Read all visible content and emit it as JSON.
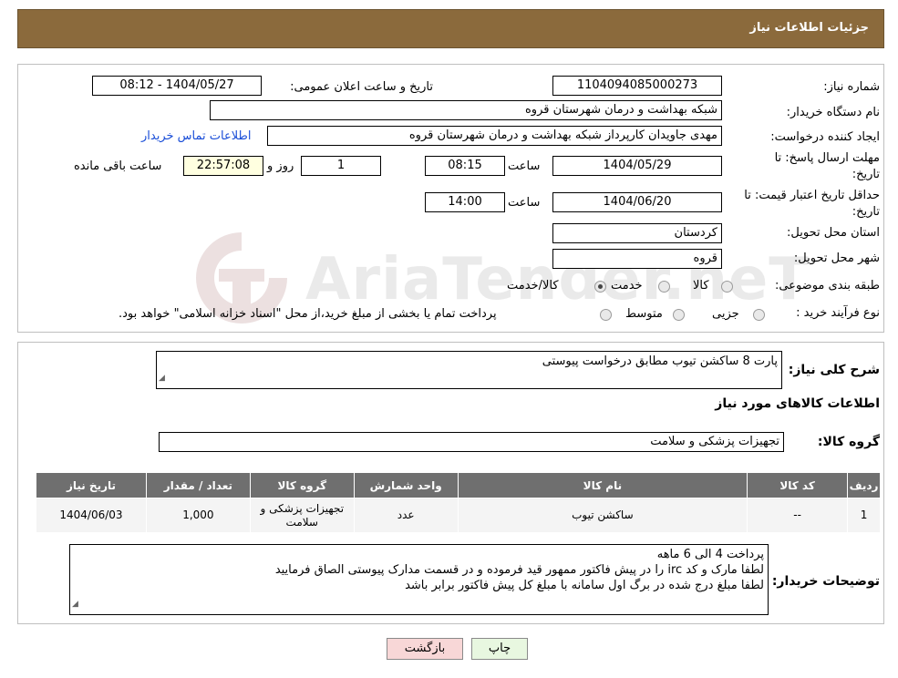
{
  "header": {
    "title": "جزئیات اطلاعات نیاز"
  },
  "fields": {
    "need_number_label": "شماره نیاز:",
    "need_number": "1104094085000273",
    "announce_label": "تاریخ و ساعت اعلان عمومی:",
    "announce_value": "1404/05/27 - 08:12",
    "buyer_org_label": "نام دستگاه خریدار:",
    "buyer_org": "شبکه بهداشت و درمان شهرستان قروه",
    "requester_label": "ایجاد کننده درخواست:",
    "requester": "مهدی جاویدان کارپرداز شبکه بهداشت و درمان شهرستان قروه",
    "contact_link": "اطلاعات تماس خریدار",
    "deadline_label_1": "مهلت ارسال پاسخ: تا",
    "deadline_label_2": "تاریخ:",
    "deadline_date": "1404/05/29",
    "time_label": "ساعت",
    "deadline_time": "08:15",
    "days_value": "1",
    "days_label": "روز و",
    "remaining_time": "22:57:08",
    "remaining_label": "ساعت باقی مانده",
    "validity_label_1": "حداقل تاریخ اعتبار قیمت: تا",
    "validity_label_2": "تاریخ:",
    "validity_date": "1404/06/20",
    "validity_time": "14:00",
    "province_label": "استان محل تحویل:",
    "province": "کردستان",
    "city_label": "شهر محل تحویل:",
    "city": "قروه",
    "category_label": "طبقه بندی موضوعی:",
    "category_options": [
      "کالا",
      "خدمت",
      "کالا/خدمت"
    ],
    "purchase_type_label": "نوع فرآیند خرید :",
    "purchase_options": [
      "جزیی",
      "متوسط"
    ],
    "purchase_note": "پرداخت تمام یا بخشی از مبلغ خرید،از محل \"اسناد خزانه اسلامی\" خواهد بود."
  },
  "description": {
    "label": "شرح کلی نیاز:",
    "text": "پارت 8 ساکشن تیوب مطابق درخواست پیوستی",
    "goods_info_title": "اطلاعات کالاهای مورد نیاز",
    "group_label": "گروه کالا:",
    "group_value": "تجهیزات پزشکی و سلامت"
  },
  "table": {
    "headers": [
      "ردیف",
      "کد کالا",
      "نام کالا",
      "واحد شمارش",
      "گروه کالا",
      "تعداد / مقدار",
      "تاریخ نیاز"
    ],
    "rows": [
      [
        "1",
        "--",
        "ساکشن تیوب",
        "عدد",
        "تجهیزات پزشکی و سلامت",
        "1,000",
        "1404/06/03"
      ]
    ]
  },
  "buyer_notes": {
    "label": "توضیحات خریدار:",
    "line1": "پرداخت 4 الی 6 ماهه",
    "line2": "لطفا مارک و کد irc  را در پیش فاکتور ممهور قید فرموده و در قسمت مدارک پیوستی الصاق فرمایید",
    "line3": "لطفا مبلغ درج شده در برگ اول سامانه با مبلغ کل پیش فاکتور برابر باشد"
  },
  "buttons": {
    "print": "چاپ",
    "back": "بازگشت"
  },
  "watermark": "AriaTender.neT",
  "colors": {
    "header": "#8b6a3c",
    "table_header": "#6f6f6f",
    "back_button": "#f8d7d7",
    "print_button": "#e8f7e0",
    "yellow_box": "#ffffe0"
  }
}
